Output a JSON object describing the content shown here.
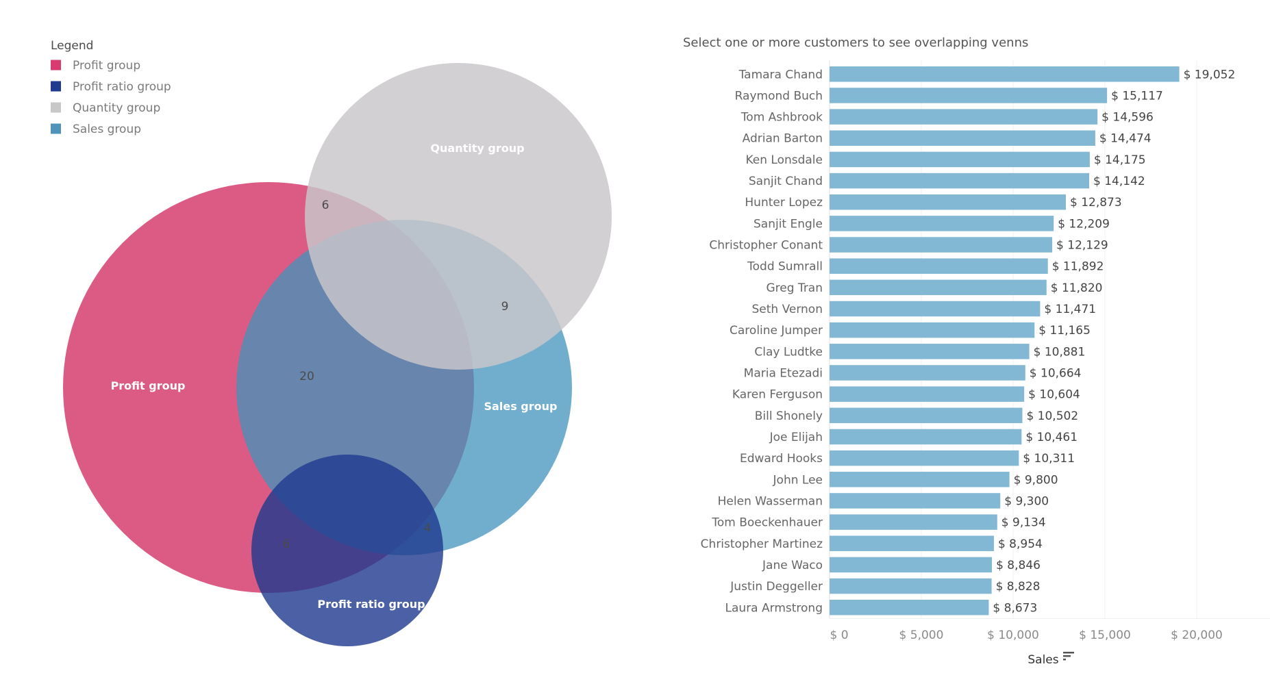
{
  "legend": {
    "title": "Legend",
    "items": [
      {
        "label": "Profit group",
        "color": "#D93B6E"
      },
      {
        "label": "Profit ratio group",
        "color": "#1F3A8F"
      },
      {
        "label": "Quantity group",
        "color": "#C8C8C8"
      },
      {
        "label": "Sales group",
        "color": "#4E93BA"
      }
    ]
  },
  "venn": {
    "sets": [
      {
        "key": "profit",
        "label": "Profit group",
        "color": "#DB5B84"
      },
      {
        "key": "sales",
        "label": "Sales group",
        "color": "#4293BC"
      },
      {
        "key": "quantity",
        "label": "Quantity group",
        "color": "#C9C7CA"
      },
      {
        "key": "profit_ratio",
        "label": "Profit ratio group",
        "color": "#1F3A8F"
      }
    ],
    "intersections": [
      {
        "sets": [
          "profit",
          "quantity"
        ],
        "count": "6"
      },
      {
        "sets": [
          "quantity",
          "sales"
        ],
        "count": "9"
      },
      {
        "sets": [
          "profit",
          "sales"
        ],
        "count": "20"
      },
      {
        "sets": [
          "sales",
          "profit_ratio"
        ],
        "count": "4"
      },
      {
        "sets": [
          "profit",
          "profit_ratio"
        ],
        "count": "6"
      }
    ]
  },
  "chart_data": {
    "type": "bar",
    "orientation": "horizontal",
    "title": "Select one or more customers to see overlapping venns",
    "xlabel": "Sales",
    "ylabel": "",
    "xlim": [
      0,
      20000
    ],
    "xticks": [
      0,
      5000,
      10000,
      15000,
      20000
    ],
    "xtick_labels": [
      "$ 0",
      "$ 5,000",
      "$ 10,000",
      "$ 15,000",
      "$ 20,000"
    ],
    "grid": true,
    "bar_color": "#83B8D4",
    "sort_icon": "sort-descending-icon",
    "categories": [
      "Tamara Chand",
      "Raymond Buch",
      "Tom Ashbrook",
      "Adrian Barton",
      "Ken Lonsdale",
      "Sanjit Chand",
      "Hunter Lopez",
      "Sanjit Engle",
      "Christopher Conant",
      "Todd Sumrall",
      "Greg Tran",
      "Seth Vernon",
      "Caroline Jumper",
      "Clay Ludtke",
      "Maria Etezadi",
      "Karen Ferguson",
      "Bill Shonely",
      "Joe Elijah",
      "Edward Hooks",
      "John Lee",
      "Helen Wasserman",
      "Tom Boeckenhauer",
      "Christopher Martinez",
      "Jane Waco",
      "Justin Deggeller",
      "Laura Armstrong"
    ],
    "values": [
      19052,
      15117,
      14596,
      14474,
      14175,
      14142,
      12873,
      12209,
      12129,
      11892,
      11820,
      11471,
      11165,
      10881,
      10664,
      10604,
      10502,
      10461,
      10311,
      9800,
      9300,
      9134,
      8954,
      8846,
      8828,
      8673
    ],
    "value_labels": [
      "$ 19,052",
      "$ 15,117",
      "$ 14,596",
      "$ 14,474",
      "$ 14,175",
      "$ 14,142",
      "$ 12,873",
      "$ 12,209",
      "$ 12,129",
      "$ 11,892",
      "$ 11,820",
      "$ 11,471",
      "$ 11,165",
      "$ 10,881",
      "$ 10,664",
      "$ 10,604",
      "$ 10,502",
      "$ 10,461",
      "$ 10,311",
      "$ 9,800",
      "$ 9,300",
      "$ 9,134",
      "$ 8,954",
      "$ 8,846",
      "$ 8,828",
      "$ 8,673"
    ]
  }
}
